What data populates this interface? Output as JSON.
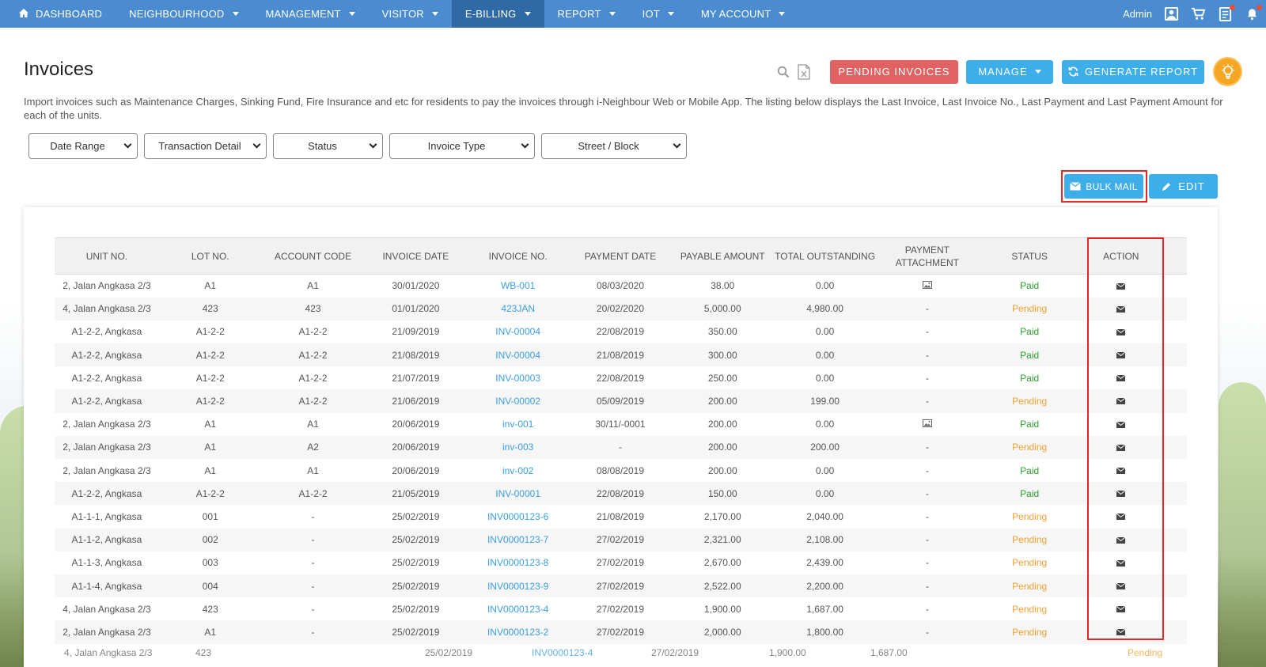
{
  "nav": {
    "items": [
      {
        "label": "DASHBOARD",
        "caret": false,
        "active": false
      },
      {
        "label": "NEIGHBOURHOOD",
        "caret": true,
        "active": false
      },
      {
        "label": "MANAGEMENT",
        "caret": true,
        "active": false
      },
      {
        "label": "VISITOR",
        "caret": true,
        "active": false
      },
      {
        "label": "E-BILLING",
        "caret": true,
        "active": true
      },
      {
        "label": "REPORT",
        "caret": true,
        "active": false
      },
      {
        "label": "IOT",
        "caret": true,
        "active": false
      },
      {
        "label": "MY ACCOUNT",
        "caret": true,
        "active": false
      }
    ],
    "user": "Admin"
  },
  "page": {
    "title": "Invoices",
    "description": "Import invoices such as Maintenance Charges, Sinking Fund, Fire Insurance and etc for residents to pay the invoices through i-Neighbour Web or Mobile App. The listing below displays the Last Invoice, Last Invoice No., Last Payment and Last Payment Amount for each of the units."
  },
  "toolbar": {
    "pending_label": "PENDING INVOICES",
    "manage_label": "MANAGE",
    "generate_label": "GENERATE REPORT",
    "bulk_mail_label": "BULK MAIL",
    "edit_label": "EDIT"
  },
  "filters": [
    "Date Range",
    "Transaction Detail",
    "Status",
    "Invoice Type",
    "Street / Block"
  ],
  "table": {
    "headers": [
      "UNIT NO.",
      "LOT NO.",
      "ACCOUNT CODE",
      "INVOICE DATE",
      "INVOICE NO.",
      "PAYMENT DATE",
      "PAYABLE AMOUNT",
      "TOTAL OUTSTANDING",
      "PAYMENT ATTACHMENT",
      "STATUS",
      "ACTION"
    ],
    "rows": [
      {
        "unit": "2, Jalan Angkasa 2/3",
        "lot": "A1",
        "account": "A1",
        "inv_date": "30/01/2020",
        "inv_no": "WB-001",
        "pay_date": "08/03/2020",
        "payable": "38.00",
        "outstanding": "0.00",
        "attachment": "image",
        "status": "Paid"
      },
      {
        "unit": "4, Jalan Angkasa 2/3",
        "lot": "423",
        "account": "423",
        "inv_date": "01/01/2020",
        "inv_no": "423JAN",
        "pay_date": "20/02/2020",
        "payable": "5,000.00",
        "outstanding": "4,980.00",
        "attachment": "-",
        "status": "Pending"
      },
      {
        "unit": "A1-2-2, Angkasa",
        "lot": "A1-2-2",
        "account": "A1-2-2",
        "inv_date": "21/09/2019",
        "inv_no": "INV-00004",
        "pay_date": "22/08/2019",
        "payable": "350.00",
        "outstanding": "0.00",
        "attachment": "-",
        "status": "Paid"
      },
      {
        "unit": "A1-2-2, Angkasa",
        "lot": "A1-2-2",
        "account": "A1-2-2",
        "inv_date": "21/08/2019",
        "inv_no": "INV-00004",
        "pay_date": "21/08/2019",
        "payable": "300.00",
        "outstanding": "0.00",
        "attachment": "-",
        "status": "Paid"
      },
      {
        "unit": "A1-2-2, Angkasa",
        "lot": "A1-2-2",
        "account": "A1-2-2",
        "inv_date": "21/07/2019",
        "inv_no": "INV-00003",
        "pay_date": "22/08/2019",
        "payable": "250.00",
        "outstanding": "0.00",
        "attachment": "-",
        "status": "Paid"
      },
      {
        "unit": "A1-2-2, Angkasa",
        "lot": "A1-2-2",
        "account": "A1-2-2",
        "inv_date": "21/06/2019",
        "inv_no": "INV-00002",
        "pay_date": "05/09/2019",
        "payable": "200.00",
        "outstanding": "199.00",
        "attachment": "-",
        "status": "Pending"
      },
      {
        "unit": "2, Jalan Angkasa 2/3",
        "lot": "A1",
        "account": "A1",
        "inv_date": "20/06/2019",
        "inv_no": "inv-001",
        "pay_date": "30/11/-0001",
        "payable": "200.00",
        "outstanding": "0.00",
        "attachment": "image",
        "status": "Paid"
      },
      {
        "unit": "2, Jalan Angkasa 2/3",
        "lot": "A1",
        "account": "A2",
        "inv_date": "20/06/2019",
        "inv_no": "inv-003",
        "pay_date": "-",
        "payable": "200.00",
        "outstanding": "200.00",
        "attachment": "-",
        "status": "Pending"
      },
      {
        "unit": "2, Jalan Angkasa 2/3",
        "lot": "A1",
        "account": "A1",
        "inv_date": "20/06/2019",
        "inv_no": "inv-002",
        "pay_date": "08/08/2019",
        "payable": "200.00",
        "outstanding": "0.00",
        "attachment": "-",
        "status": "Paid"
      },
      {
        "unit": "A1-2-2, Angkasa",
        "lot": "A1-2-2",
        "account": "A1-2-2",
        "inv_date": "21/05/2019",
        "inv_no": "INV-00001",
        "pay_date": "22/08/2019",
        "payable": "150.00",
        "outstanding": "0.00",
        "attachment": "-",
        "status": "Paid"
      },
      {
        "unit": "A1-1-1, Angkasa",
        "lot": "001",
        "account": "-",
        "inv_date": "25/02/2019",
        "inv_no": "INV0000123-6",
        "pay_date": "21/08/2019",
        "payable": "2,170.00",
        "outstanding": "2,040.00",
        "attachment": "-",
        "status": "Pending"
      },
      {
        "unit": "A1-1-2, Angkasa",
        "lot": "002",
        "account": "-",
        "inv_date": "25/02/2019",
        "inv_no": "INV0000123-7",
        "pay_date": "27/02/2019",
        "payable": "2,321.00",
        "outstanding": "2,108.00",
        "attachment": "-",
        "status": "Pending"
      },
      {
        "unit": "A1-1-3, Angkasa",
        "lot": "003",
        "account": "-",
        "inv_date": "25/02/2019",
        "inv_no": "INV0000123-8",
        "pay_date": "27/02/2019",
        "payable": "2,670.00",
        "outstanding": "2,439.00",
        "attachment": "-",
        "status": "Pending"
      },
      {
        "unit": "A1-1-4, Angkasa",
        "lot": "004",
        "account": "-",
        "inv_date": "25/02/2019",
        "inv_no": "INV0000123-9",
        "pay_date": "27/02/2019",
        "payable": "2,522.00",
        "outstanding": "2,200.00",
        "attachment": "-",
        "status": "Pending"
      },
      {
        "unit": "4, Jalan Angkasa 2/3",
        "lot": "423",
        "account": "-",
        "inv_date": "25/02/2019",
        "inv_no": "INV0000123-4",
        "pay_date": "27/02/2019",
        "payable": "1,900.00",
        "outstanding": "1,687.00",
        "attachment": "-",
        "status": "Pending"
      },
      {
        "unit": "2, Jalan Angkasa 2/3",
        "lot": "A1",
        "account": "-",
        "inv_date": "25/02/2019",
        "inv_no": "INV0000123-2",
        "pay_date": "27/02/2019",
        "payable": "2,000.00",
        "outstanding": "1,800.00",
        "attachment": "-",
        "status": "Pending"
      }
    ],
    "partial_row": {
      "unit": "4, Jalan Angkasa 2/3",
      "lot": "423",
      "inv_date": "25/02/2019",
      "inv_no": "INV0000123-4",
      "pay_date": "27/02/2019",
      "payable": "1,900.00",
      "outstanding": "1,687.00",
      "status": "Pending"
    }
  },
  "colors": {
    "nav_bg": "#4a8ccf",
    "nav_active": "#2f6aa6",
    "pending_button": "#e06262",
    "blue_button": "#3eaee8",
    "paid": "#2c9e2c",
    "pending": "#f0a232",
    "link": "#3a9fe0",
    "highlight_outline": "#e32626"
  }
}
